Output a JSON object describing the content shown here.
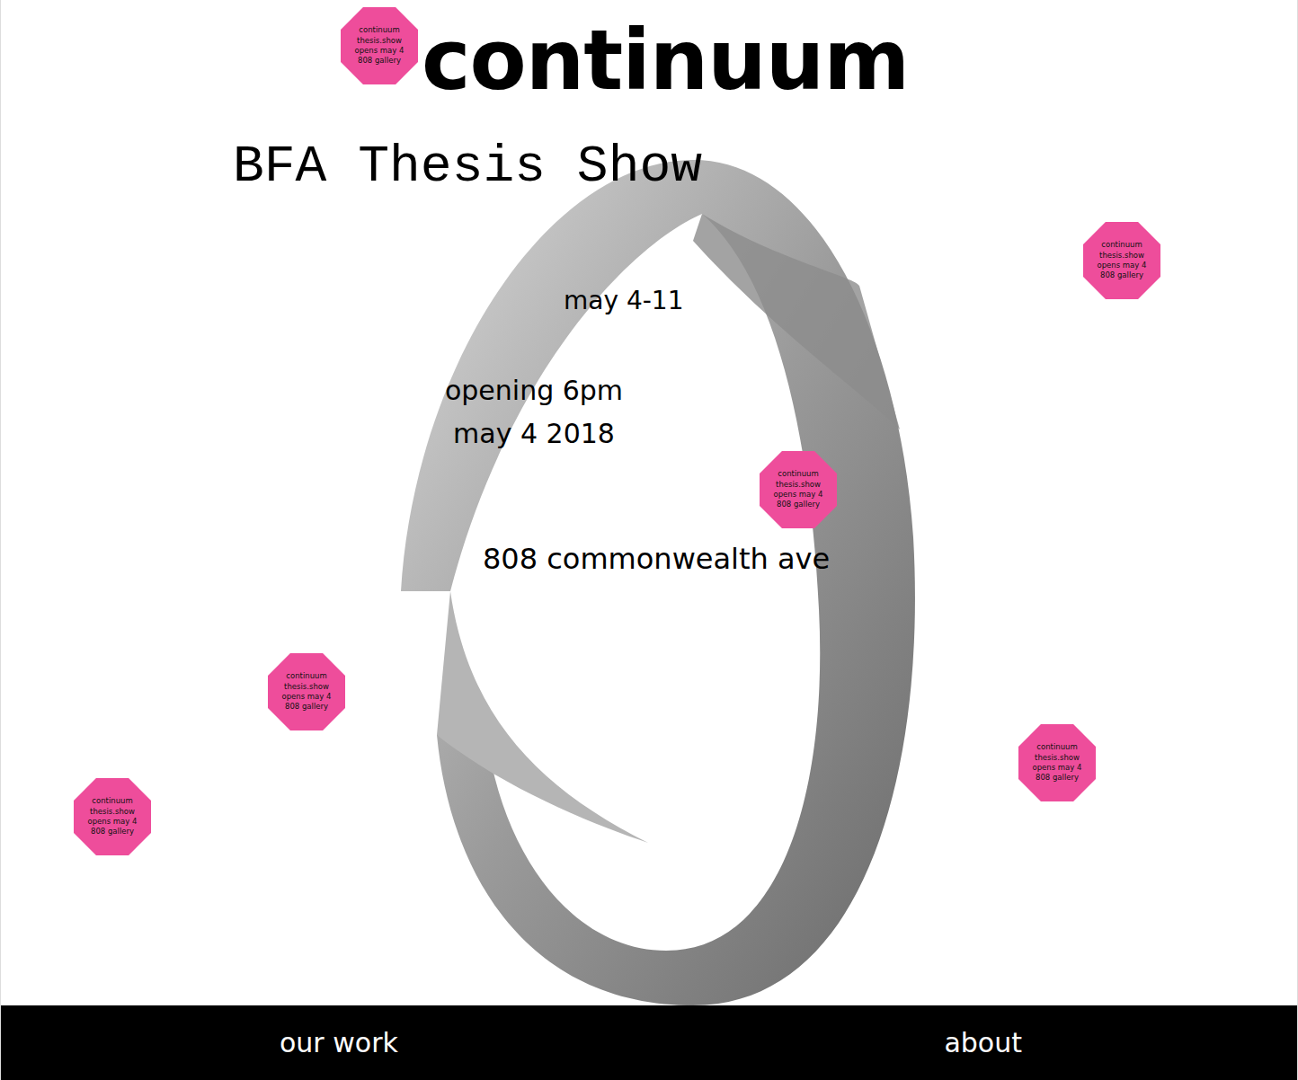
{
  "title": "continuum",
  "subtitle": "BFA Thesis Show",
  "dates": "may 4-11",
  "opening": [
    "opening 6pm",
    "may 4 2018"
  ],
  "address": "808 commonwealth ave",
  "badges": [
    {
      "lines": [
        "continuum",
        "thesis.show",
        "opens may 4",
        "808 gallery"
      ]
    },
    {
      "lines": [
        "continuum",
        "thesis.show",
        "opens may 4",
        "808 gallery"
      ]
    },
    {
      "lines": [
        "continuum",
        "thesis.show",
        "opens may 4",
        "808 gallery"
      ]
    },
    {
      "lines": [
        "continuum",
        "thesis.show",
        "opens may 4",
        "808 gallery"
      ]
    },
    {
      "lines": [
        "continuum",
        "thesis.show",
        "opens may 4",
        "808 gallery"
      ]
    },
    {
      "lines": [
        "continuum",
        "thesis.show",
        "opens may 4",
        "808 gallery"
      ]
    }
  ],
  "nav": [
    {
      "label": "our work"
    },
    {
      "label": "about"
    }
  ]
}
